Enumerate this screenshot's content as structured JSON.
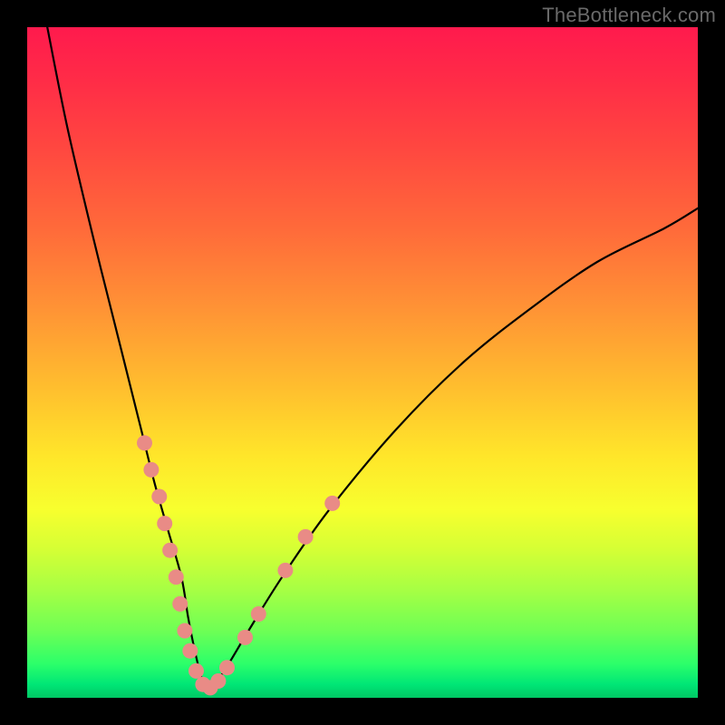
{
  "watermark": "TheBottleneck.com",
  "colors": {
    "frame": "#000000",
    "curve": "#000000",
    "dots": "#e98b86",
    "gradient": [
      "#ff1a4d",
      "#ff2c47",
      "#ff4740",
      "#ff6a3a",
      "#ff9335",
      "#ffbf2e",
      "#ffe62a",
      "#f7ff2e",
      "#d4ff35",
      "#a6ff44",
      "#6eff55",
      "#2bff6a",
      "#00e676",
      "#00c864"
    ]
  },
  "chart_data": {
    "type": "line",
    "title": "",
    "xlabel": "",
    "ylabel": "",
    "x_range": [
      0,
      100
    ],
    "y_range": [
      0,
      100
    ],
    "description": "V-shaped bottleneck curve overlaid on a vertical rainbow gradient. Left branch descends steeply from top toward the minimum near x≈26; right branch rises more gradually toward the right edge. Scattered reference dots cluster near the bottom of the V on both branches. No axes are drawn.",
    "curve": {
      "x": [
        3,
        6,
        10,
        14,
        17,
        19,
        21,
        23,
        24,
        25,
        26,
        27,
        28,
        30,
        33,
        38,
        45,
        55,
        65,
        75,
        85,
        95,
        100
      ],
      "y": [
        100,
        85,
        68,
        52,
        40,
        32,
        25,
        18,
        12,
        7,
        3,
        1,
        2,
        5,
        10,
        18,
        28,
        40,
        50,
        58,
        65,
        70,
        73
      ]
    },
    "dots": [
      {
        "x": 17.5,
        "y": 38
      },
      {
        "x": 18.5,
        "y": 34
      },
      {
        "x": 19.7,
        "y": 30
      },
      {
        "x": 20.5,
        "y": 26
      },
      {
        "x": 21.3,
        "y": 22
      },
      {
        "x": 22.2,
        "y": 18
      },
      {
        "x": 22.8,
        "y": 14
      },
      {
        "x": 23.5,
        "y": 10
      },
      {
        "x": 24.3,
        "y": 7
      },
      {
        "x": 25.2,
        "y": 4
      },
      {
        "x": 26.2,
        "y": 2
      },
      {
        "x": 27.3,
        "y": 1.5
      },
      {
        "x": 28.5,
        "y": 2.5
      },
      {
        "x": 29.8,
        "y": 4.5
      },
      {
        "x": 32.5,
        "y": 9
      },
      {
        "x": 34.5,
        "y": 12.5
      },
      {
        "x": 38.5,
        "y": 19
      },
      {
        "x": 41.5,
        "y": 24
      },
      {
        "x": 45.5,
        "y": 29
      }
    ]
  }
}
